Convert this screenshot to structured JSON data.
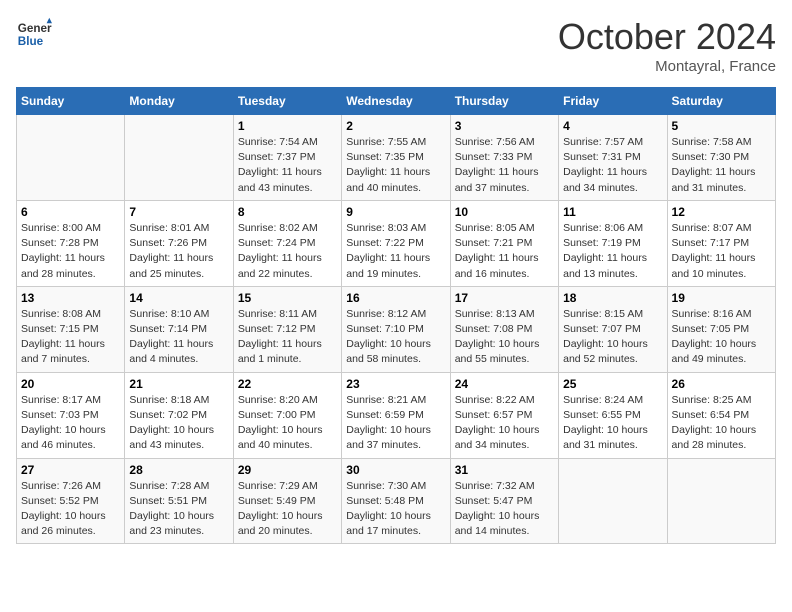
{
  "header": {
    "logo_line1": "General",
    "logo_line2": "Blue",
    "month": "October 2024",
    "location": "Montayral, France"
  },
  "weekdays": [
    "Sunday",
    "Monday",
    "Tuesday",
    "Wednesday",
    "Thursday",
    "Friday",
    "Saturday"
  ],
  "weeks": [
    [
      {
        "day": "",
        "info": ""
      },
      {
        "day": "",
        "info": ""
      },
      {
        "day": "1",
        "info": "Sunrise: 7:54 AM\nSunset: 7:37 PM\nDaylight: 11 hours and 43 minutes."
      },
      {
        "day": "2",
        "info": "Sunrise: 7:55 AM\nSunset: 7:35 PM\nDaylight: 11 hours and 40 minutes."
      },
      {
        "day": "3",
        "info": "Sunrise: 7:56 AM\nSunset: 7:33 PM\nDaylight: 11 hours and 37 minutes."
      },
      {
        "day": "4",
        "info": "Sunrise: 7:57 AM\nSunset: 7:31 PM\nDaylight: 11 hours and 34 minutes."
      },
      {
        "day": "5",
        "info": "Sunrise: 7:58 AM\nSunset: 7:30 PM\nDaylight: 11 hours and 31 minutes."
      }
    ],
    [
      {
        "day": "6",
        "info": "Sunrise: 8:00 AM\nSunset: 7:28 PM\nDaylight: 11 hours and 28 minutes."
      },
      {
        "day": "7",
        "info": "Sunrise: 8:01 AM\nSunset: 7:26 PM\nDaylight: 11 hours and 25 minutes."
      },
      {
        "day": "8",
        "info": "Sunrise: 8:02 AM\nSunset: 7:24 PM\nDaylight: 11 hours and 22 minutes."
      },
      {
        "day": "9",
        "info": "Sunrise: 8:03 AM\nSunset: 7:22 PM\nDaylight: 11 hours and 19 minutes."
      },
      {
        "day": "10",
        "info": "Sunrise: 8:05 AM\nSunset: 7:21 PM\nDaylight: 11 hours and 16 minutes."
      },
      {
        "day": "11",
        "info": "Sunrise: 8:06 AM\nSunset: 7:19 PM\nDaylight: 11 hours and 13 minutes."
      },
      {
        "day": "12",
        "info": "Sunrise: 8:07 AM\nSunset: 7:17 PM\nDaylight: 11 hours and 10 minutes."
      }
    ],
    [
      {
        "day": "13",
        "info": "Sunrise: 8:08 AM\nSunset: 7:15 PM\nDaylight: 11 hours and 7 minutes."
      },
      {
        "day": "14",
        "info": "Sunrise: 8:10 AM\nSunset: 7:14 PM\nDaylight: 11 hours and 4 minutes."
      },
      {
        "day": "15",
        "info": "Sunrise: 8:11 AM\nSunset: 7:12 PM\nDaylight: 11 hours and 1 minute."
      },
      {
        "day": "16",
        "info": "Sunrise: 8:12 AM\nSunset: 7:10 PM\nDaylight: 10 hours and 58 minutes."
      },
      {
        "day": "17",
        "info": "Sunrise: 8:13 AM\nSunset: 7:08 PM\nDaylight: 10 hours and 55 minutes."
      },
      {
        "day": "18",
        "info": "Sunrise: 8:15 AM\nSunset: 7:07 PM\nDaylight: 10 hours and 52 minutes."
      },
      {
        "day": "19",
        "info": "Sunrise: 8:16 AM\nSunset: 7:05 PM\nDaylight: 10 hours and 49 minutes."
      }
    ],
    [
      {
        "day": "20",
        "info": "Sunrise: 8:17 AM\nSunset: 7:03 PM\nDaylight: 10 hours and 46 minutes."
      },
      {
        "day": "21",
        "info": "Sunrise: 8:18 AM\nSunset: 7:02 PM\nDaylight: 10 hours and 43 minutes."
      },
      {
        "day": "22",
        "info": "Sunrise: 8:20 AM\nSunset: 7:00 PM\nDaylight: 10 hours and 40 minutes."
      },
      {
        "day": "23",
        "info": "Sunrise: 8:21 AM\nSunset: 6:59 PM\nDaylight: 10 hours and 37 minutes."
      },
      {
        "day": "24",
        "info": "Sunrise: 8:22 AM\nSunset: 6:57 PM\nDaylight: 10 hours and 34 minutes."
      },
      {
        "day": "25",
        "info": "Sunrise: 8:24 AM\nSunset: 6:55 PM\nDaylight: 10 hours and 31 minutes."
      },
      {
        "day": "26",
        "info": "Sunrise: 8:25 AM\nSunset: 6:54 PM\nDaylight: 10 hours and 28 minutes."
      }
    ],
    [
      {
        "day": "27",
        "info": "Sunrise: 7:26 AM\nSunset: 5:52 PM\nDaylight: 10 hours and 26 minutes."
      },
      {
        "day": "28",
        "info": "Sunrise: 7:28 AM\nSunset: 5:51 PM\nDaylight: 10 hours and 23 minutes."
      },
      {
        "day": "29",
        "info": "Sunrise: 7:29 AM\nSunset: 5:49 PM\nDaylight: 10 hours and 20 minutes."
      },
      {
        "day": "30",
        "info": "Sunrise: 7:30 AM\nSunset: 5:48 PM\nDaylight: 10 hours and 17 minutes."
      },
      {
        "day": "31",
        "info": "Sunrise: 7:32 AM\nSunset: 5:47 PM\nDaylight: 10 hours and 14 minutes."
      },
      {
        "day": "",
        "info": ""
      },
      {
        "day": "",
        "info": ""
      }
    ]
  ]
}
